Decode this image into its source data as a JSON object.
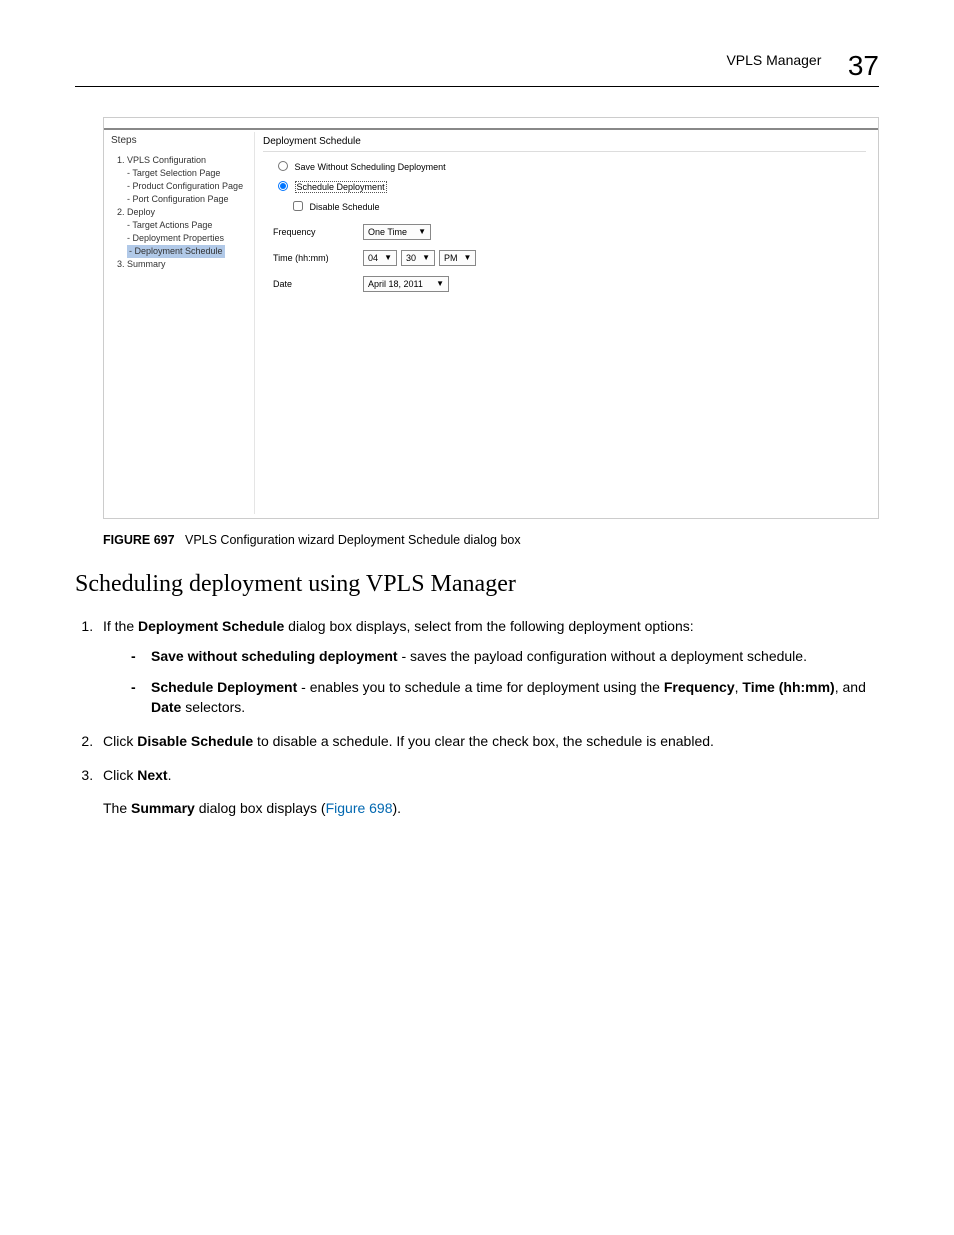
{
  "header": {
    "title": "VPLS Manager",
    "chapter": "37"
  },
  "screenshot": {
    "steps_header": "Steps",
    "steps": {
      "s1": "1. VPLS Configuration",
      "s1a": "- Target Selection Page",
      "s1b": "- Product Configuration Page",
      "s1c": "- Port Configuration Page",
      "s2": "2. Deploy",
      "s2a": "- Target Actions Page",
      "s2b": "- Deployment Properties",
      "s2c": "- Deployment Schedule",
      "s3": "3. Summary"
    },
    "panel_title": "Deployment Schedule",
    "radio_save": "Save Without Scheduling Deployment",
    "radio_sched": "Schedule Deployment",
    "cb_disable": "Disable Schedule",
    "rows": {
      "freq_label": "Frequency",
      "freq_value": "One Time",
      "time_label": "Time (hh:mm)",
      "time_hh": "04",
      "time_mm": "30",
      "time_ampm": "PM",
      "date_label": "Date",
      "date_value": "April 18, 2011"
    }
  },
  "caption": {
    "fig": "FIGURE 697",
    "text": "VPLS Configuration wizard Deployment Schedule dialog box"
  },
  "heading": "Scheduling deployment using VPLS Manager",
  "body": {
    "li1_a": "If the ",
    "li1_b": "Deployment Schedule",
    "li1_c": " dialog box displays, select from the following deployment options:",
    "opt1_b": "Save without scheduling deployment",
    "opt1_t": " - saves the payload configuration without a deployment schedule.",
    "opt2_b": "Schedule Deployment",
    "opt2_t1": " - enables you to schedule a time for deployment using the ",
    "opt2_t2": "Frequency",
    "opt2_t3": ", ",
    "opt2_t4": "Time (hh:mm)",
    "opt2_t5": ", and ",
    "opt2_t6": "Date",
    "opt2_t7": " selectors.",
    "li2_a": "Click ",
    "li2_b": "Disable Schedule",
    "li2_c": " to disable a schedule. If you clear the check box, the schedule is enabled.",
    "li3_a": "Click ",
    "li3_b": "Next",
    "li3_c": ".",
    "li3_follow_a": "The ",
    "li3_follow_b": "Summary",
    "li3_follow_c": " dialog box displays (",
    "li3_follow_link": "Figure 698",
    "li3_follow_d": ")."
  }
}
